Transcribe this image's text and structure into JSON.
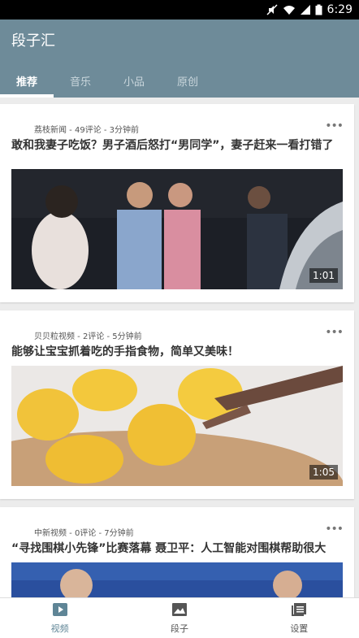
{
  "status_bar": {
    "time": "6:29"
  },
  "app": {
    "title": "段子汇"
  },
  "tabs": [
    {
      "label": "推荐",
      "active": true
    },
    {
      "label": "音乐",
      "active": false
    },
    {
      "label": "小品",
      "active": false
    },
    {
      "label": "原创",
      "active": false
    }
  ],
  "feed": [
    {
      "meta": "荔枝新闻 - 49评论 - 3分钟前",
      "title": "敢和我妻子吃饭？男子酒后怒打“男同学”，妻子赶来一看打错了",
      "duration": "1:01"
    },
    {
      "meta": "贝贝粒视频 - 2评论 - 5分钟前",
      "title": "能够让宝宝抓着吃的手指食物，简单又美味！",
      "duration": "1:05"
    },
    {
      "meta": "中新视频 - 0评论 - 7分钟前",
      "title": "“寻找围棋小先锋”比赛落幕 聂卫平：人工智能对围棋帮助很大",
      "duration": ""
    }
  ],
  "bottom_nav": [
    {
      "label": "视频",
      "icon": "video-icon",
      "active": true
    },
    {
      "label": "段子",
      "icon": "image-icon",
      "active": false
    },
    {
      "label": "设置",
      "icon": "settings-icon",
      "active": false
    }
  ],
  "colors": {
    "app_bar": "#6e8b99",
    "active_nav": "#5f8596"
  }
}
